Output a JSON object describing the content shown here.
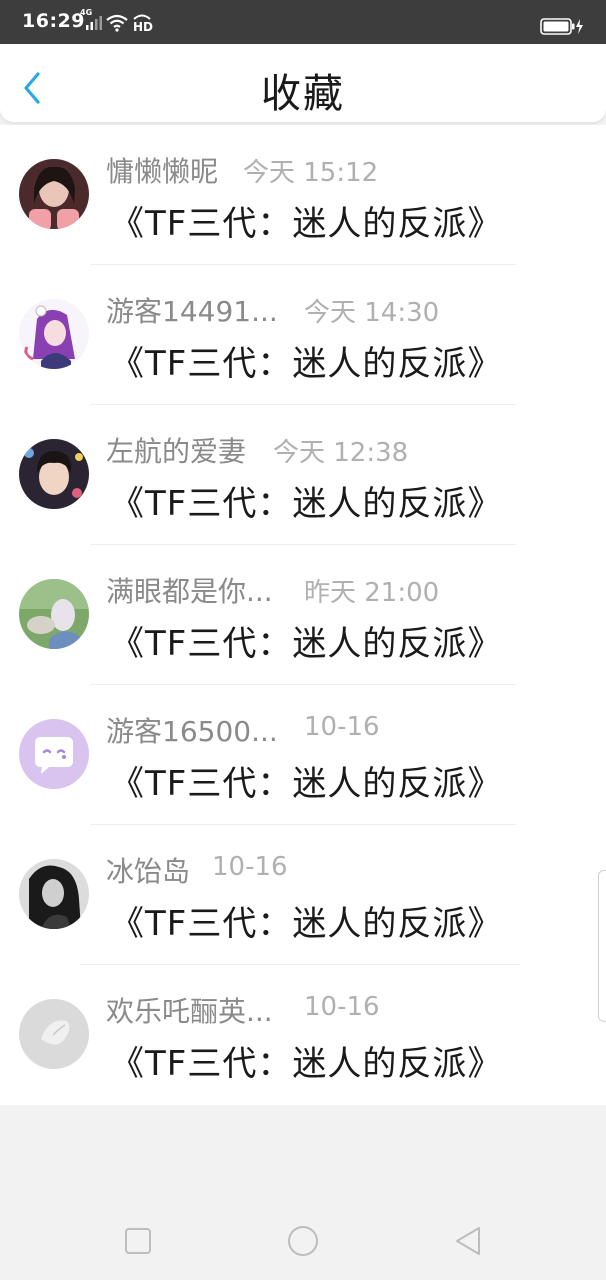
{
  "status_bar": {
    "time": "16:29",
    "network": "4G",
    "hd": "HD",
    "icons": [
      "signal-icon",
      "wifi-icon",
      "hd-icon",
      "battery-icon"
    ]
  },
  "header": {
    "title": "收藏",
    "back_icon": "chevron-left-icon",
    "accent_color": "#29a8e8"
  },
  "items": [
    {
      "name": "慵懒懒昵",
      "time": "今天 15:12",
      "book": "《TF三代：迷人的反派》",
      "avatar": "avatar-photo"
    },
    {
      "name": "游客14491...",
      "time": "今天 14:30",
      "book": "《TF三代：迷人的反派》",
      "avatar": "avatar-anime"
    },
    {
      "name": "左航的爱妻",
      "time": "今天 12:38",
      "book": "《TF三代：迷人的反派》",
      "avatar": "avatar-photo"
    },
    {
      "name": "满眼都是你...",
      "time": "昨天 21:00",
      "book": "《TF三代：迷人的反派》",
      "avatar": "avatar-photo"
    },
    {
      "name": "游客16500...",
      "time": "10-16",
      "book": "《TF三代：迷人的反派》",
      "avatar": "chat-bubble-icon"
    },
    {
      "name": "冰饴岛",
      "time": "10-16",
      "book": "《TF三代：迷人的反派》",
      "avatar": "avatar-photo"
    },
    {
      "name": "欢乐吒酾英...",
      "time": "10-16",
      "book": "《TF三代：迷人的反派》",
      "avatar": "avatar-photo"
    }
  ],
  "nav_bar": {
    "icons": [
      "recents-icon",
      "home-icon",
      "back-icon"
    ]
  }
}
